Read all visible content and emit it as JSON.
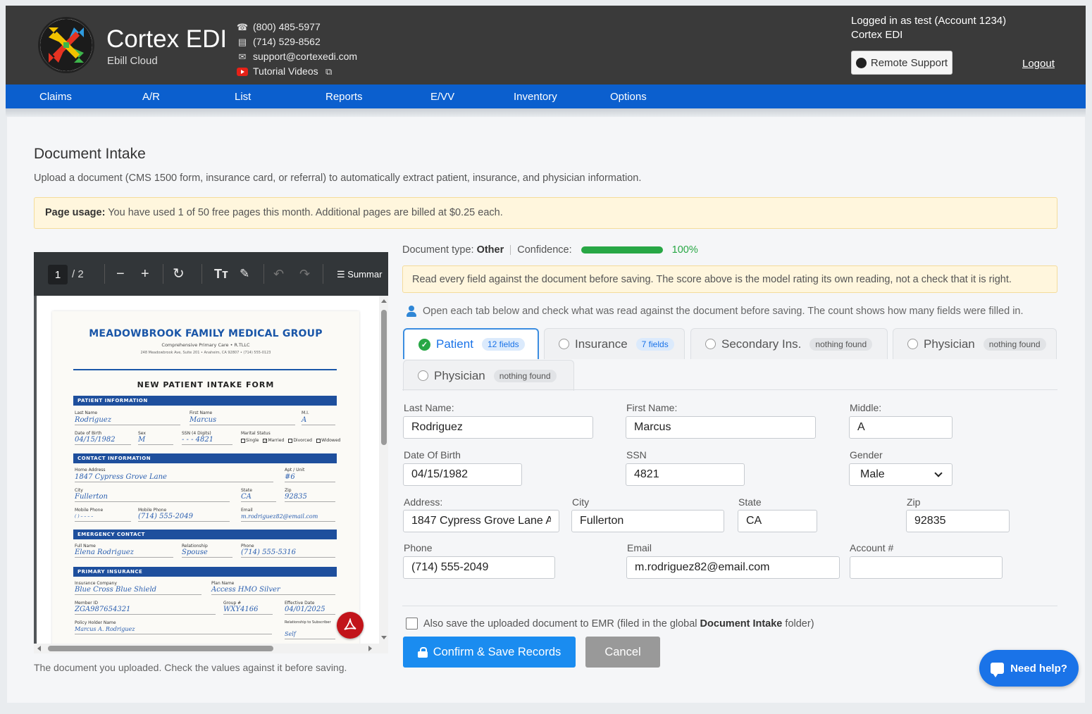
{
  "header": {
    "brand_name": "Cortex EDI",
    "brand_sub": "Ebill Cloud",
    "phone1": "(800) 485-5977",
    "phone2": "(714) 529-8562",
    "email": "support@cortexedi.com",
    "tutorial": "Tutorial Videos",
    "login_line1": "Logged in as test (Account 1234)",
    "login_line2": "Cortex EDI",
    "remote_support": "Remote Support",
    "logout": "Logout"
  },
  "nav": {
    "items": [
      "Claims",
      "A/R",
      "List",
      "Reports",
      "E/VV",
      "Inventory",
      "Options"
    ]
  },
  "page": {
    "title": "Document Intake",
    "description": "Upload a document (CMS 1500 form, insurance card, or referral) to automatically extract patient, insurance, and physician information.",
    "usage_label": "Page usage:",
    "usage_text": "You have used 1 of 50 free pages this month. Additional pages are billed at $0.25 each."
  },
  "viewer": {
    "page_current": "1",
    "page_total": "/ 2",
    "summary": "Summar",
    "caption": "The document you uploaded. Check the values against it before saving.",
    "form": {
      "org": "MEADOWBROOK FAMILY MEDICAL GROUP",
      "org_sub": "Comprehensive Primary Care • R.TLLC",
      "org_addr": "248 Meadowbrook Ave, Suite 201 • Anaheim, CA 92807 • (714) 555-0123",
      "form_title": "NEW PATIENT INTAKE FORM",
      "sec_patient": "PATIENT INFORMATION",
      "sec_contact": "CONTACT INFORMATION",
      "sec_emergency": "EMERGENCY CONTACT",
      "sec_insurance": "PRIMARY INSURANCE",
      "l_last": "Last Name",
      "v_last": "Rodriguez",
      "l_first": "First Name",
      "v_first": "Marcus",
      "l_mi": "M.I.",
      "v_mi": "A",
      "l_dob": "Date of Birth",
      "v_dob": "04/15/1982",
      "l_sex": "Sex",
      "v_sex": "M",
      "l_ssn": "SSN (4 Digits)",
      "v_ssn": "- - - 4821",
      "l_marital": "Marital Status",
      "m_single": "Single",
      "m_married": "Married",
      "m_divorced": "Divorced",
      "m_widowed": "Widowed",
      "l_addr": "Home Address",
      "v_addr": "1847 Cypress Grove Lane",
      "l_apt": "Apt / Unit",
      "v_apt": "#6",
      "l_city": "City",
      "v_city": "Fullerton",
      "l_state": "State",
      "v_state": "CA",
      "l_zip": "Zip",
      "v_zip": "92835",
      "l_mob1": "Mobile Phone",
      "v_mob1": "( ) – – – –",
      "l_mob2": "Mobile Phone",
      "v_mob2": "(714) 555-2049",
      "l_email": "Email",
      "v_email": "m.rodriguez82@email.com",
      "l_ename": "Full Name",
      "v_ename": "Elena Rodriguez",
      "l_rel": "Relationship",
      "v_rel": "Spouse",
      "l_ephone": "Phone",
      "v_ephone": "(714) 555-5316",
      "l_ins": "Insurance Company",
      "v_ins": "Blue Cross Blue Shield",
      "l_plan": "Plan Name",
      "v_plan": "Access HMO Silver",
      "l_member": "Member ID",
      "v_member": "ZGA987654321",
      "l_group": "Group #",
      "v_group": "WXY4166",
      "l_eff": "Effective Date",
      "v_eff": "04/01/2025",
      "l_holder": "Policy Holder Name",
      "v_holder": "Marcus A. Rodriguez",
      "l_relsub": "Relationship to Subscriber",
      "v_relsub": "Self"
    }
  },
  "extract": {
    "doctype_label": "Document type:",
    "doctype_value": "Other",
    "confidence_label": "Confidence:",
    "confidence_value": "100%",
    "confidence_fraction": 1.0,
    "warning": "Read every field against the document before saving. The score above is the model rating its own reading, not a check that it is right.",
    "hint": "Open each tab below and check what was read against the document before saving. The count shows how many fields were filled in.",
    "tabs": [
      {
        "label": "Patient",
        "badge": "12 fields"
      },
      {
        "label": "Insurance",
        "badge": "7 fields"
      },
      {
        "label": "Secondary Ins.",
        "badge": "nothing found"
      },
      {
        "label": "Physician",
        "badge": "nothing found"
      },
      {
        "label": "Physician",
        "badge": "nothing found"
      }
    ],
    "fields": {
      "last_name": {
        "label": "Last Name:",
        "value": "Rodriguez"
      },
      "first_name": {
        "label": "First Name:",
        "value": "Marcus"
      },
      "middle": {
        "label": "Middle:",
        "value": "A"
      },
      "dob": {
        "label": "Date Of Birth",
        "value": "04/15/1982"
      },
      "ssn": {
        "label": "SSN",
        "value": "4821"
      },
      "gender": {
        "label": "Gender",
        "value": "Male"
      },
      "address": {
        "label": "Address:",
        "value": "1847 Cypress Grove Lane A"
      },
      "city": {
        "label": "City",
        "value": "Fullerton"
      },
      "state": {
        "label": "State",
        "value": "CA"
      },
      "zip": {
        "label": "Zip",
        "value": "92835"
      },
      "phone": {
        "label": "Phone",
        "value": "(714) 555-2049"
      },
      "email": {
        "label": "Email",
        "value": "m.rodriguez82@email.com"
      },
      "account": {
        "label": "Account #",
        "value": ""
      }
    },
    "emr_text_pre": "Also save the uploaded document to EMR (filed in the global",
    "emr_text_bold": "Document Intake",
    "emr_text_post": "folder)",
    "confirm": "Confirm & Save Records",
    "cancel": "Cancel"
  },
  "help": "Need help?",
  "colors": {
    "nav": "#0b5fce",
    "header": "#3a3a3a",
    "primary": "#1a8cf0",
    "success": "#28a745",
    "warning_bg": "#fff6dd"
  },
  "icons": [
    "phone-icon",
    "fax-icon",
    "email-icon",
    "youtube-icon",
    "external-link-icon",
    "remote-support-icon",
    "zoom-out-icon",
    "zoom-in-icon",
    "rotate-icon",
    "text-icon",
    "draw-icon",
    "undo-icon",
    "redo-icon",
    "list-icon",
    "pdf-icon",
    "person-icon",
    "check-icon",
    "lock-icon",
    "chat-icon"
  ]
}
